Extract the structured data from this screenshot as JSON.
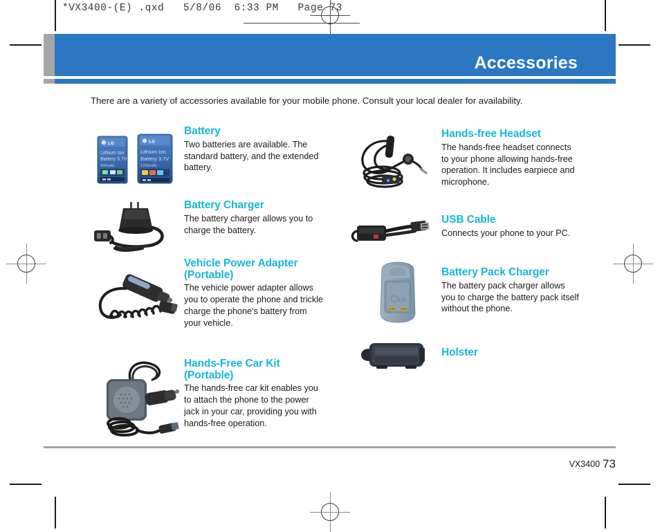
{
  "slug": {
    "text": "*VX3400-(E) .qxd   5/8/06  6:33 PM   Page 73"
  },
  "banner": {
    "title": "Accessories",
    "blue": "#2b77c1",
    "grey": "#a6a6a6"
  },
  "intro": "There are a variety of accessories available for your mobile phone. Consult your local dealer for availability.",
  "accent_color": "#16b7d4",
  "columns": {
    "left": [
      {
        "icon": "battery-pair-icon",
        "title": "Battery",
        "subtitle": "",
        "desc": "Two batteries are available. The standard battery, and the extended battery."
      },
      {
        "icon": "battery-charger-icon",
        "title": "Battery Charger",
        "subtitle": "",
        "desc": "The battery charger allows you to charge the battery."
      },
      {
        "icon": "vehicle-power-adapter-icon",
        "title": "Vehicle Power Adapter",
        "subtitle": "(Portable)",
        "desc": "The vehicle power adapter allows you to operate the phone and trickle charge the phone’s battery from your vehicle."
      },
      {
        "icon": "hands-free-car-kit-icon",
        "title": "Hands-Free Car Kit (Portable)",
        "subtitle": "",
        "desc": "The hands-free car kit enables you to attach the phone to the power jack in your car, providing you with hands-free operation."
      }
    ],
    "right": [
      {
        "icon": "hands-free-headset-icon",
        "title": "Hands-free Headset",
        "subtitle": "",
        "desc": "The hands-free headset connects to your phone allowing hands-free operation. It includes earpiece and microphone."
      },
      {
        "icon": "usb-cable-icon",
        "title": "USB Cable",
        "subtitle": "",
        "desc": "Connects your phone to your PC."
      },
      {
        "icon": "battery-pack-charger-icon",
        "title": "Battery Pack Charger",
        "subtitle": "",
        "desc": "The battery pack charger allows you to charge the battery pack itself without the phone."
      },
      {
        "icon": "holster-icon",
        "title": "Holster",
        "subtitle": "",
        "desc": ""
      }
    ]
  },
  "battery_labels": {
    "brand": "LG",
    "line1": "Lithium Ion",
    "line2": "Battery 3.7V",
    "line3a": "900mAh",
    "line3b": "1700mAh"
  },
  "footer": {
    "model": "VX3400",
    "page": "73"
  }
}
